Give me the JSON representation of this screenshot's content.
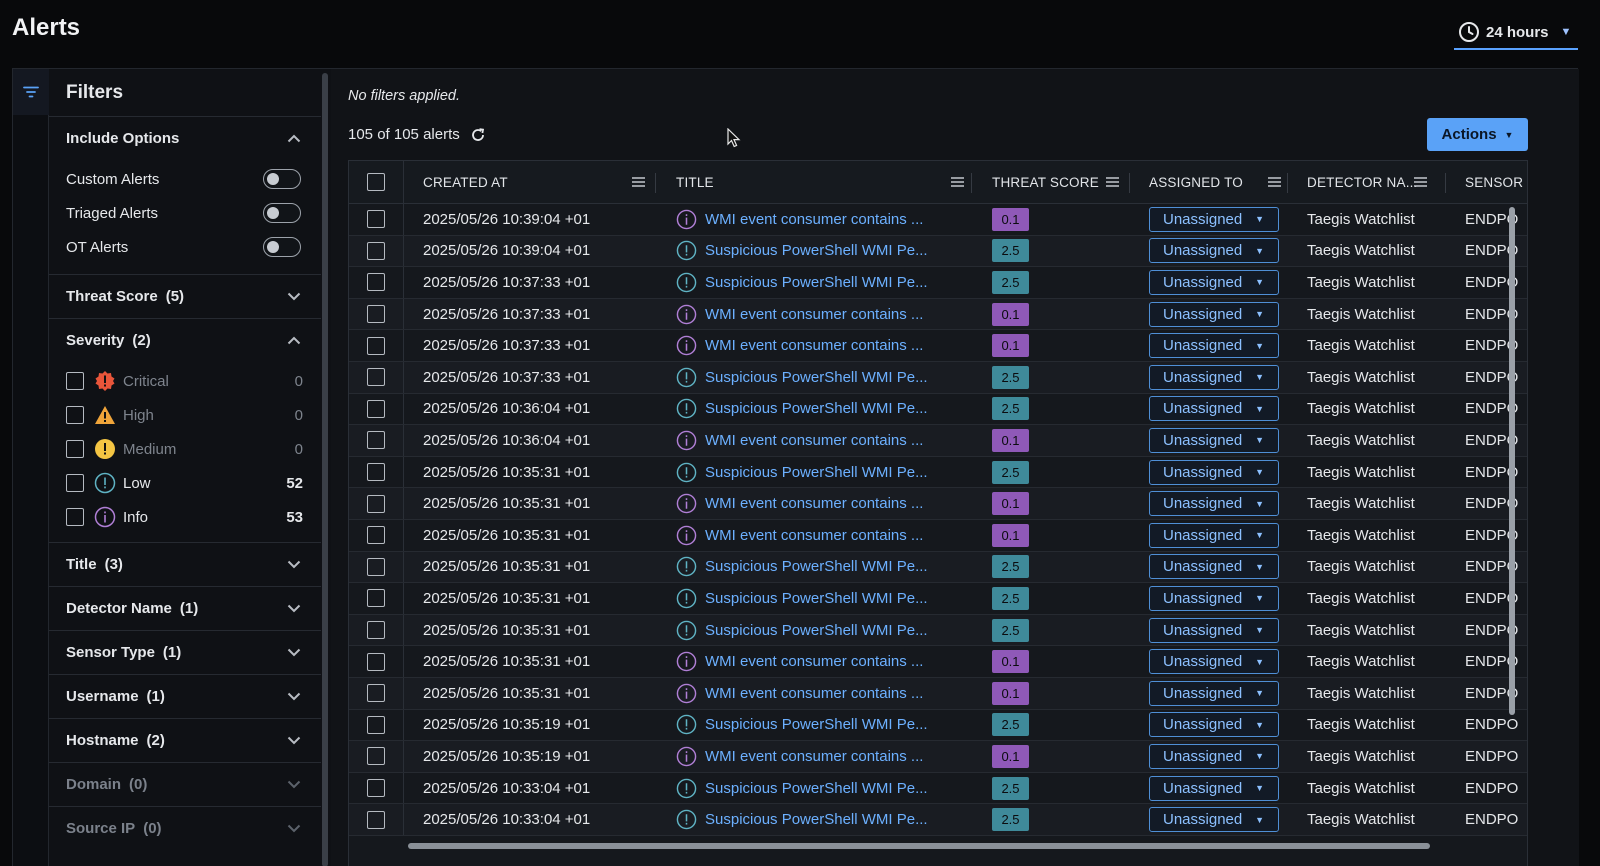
{
  "page": {
    "title": "Alerts"
  },
  "time_range": {
    "label": "24 hours"
  },
  "filters": {
    "title": "Filters",
    "include_options": {
      "label": "Include Options",
      "options": [
        {
          "label": "Custom Alerts",
          "enabled": false
        },
        {
          "label": "Triaged Alerts",
          "enabled": false
        },
        {
          "label": "OT Alerts",
          "enabled": false
        }
      ]
    },
    "threat_score": {
      "label": "Threat Score",
      "count": "(5)"
    },
    "severity": {
      "label": "Severity",
      "count": "(2)",
      "items": [
        {
          "label": "Critical",
          "count": "0",
          "icon": "critical-icon"
        },
        {
          "label": "High",
          "count": "0",
          "icon": "high-icon"
        },
        {
          "label": "Medium",
          "count": "0",
          "icon": "medium-icon"
        },
        {
          "label": "Low",
          "count": "52",
          "icon": "low-icon"
        },
        {
          "label": "Info",
          "count": "53",
          "icon": "info-icon"
        }
      ]
    },
    "title_filter": {
      "label": "Title",
      "count": "(3)"
    },
    "detector_name": {
      "label": "Detector Name",
      "count": "(1)"
    },
    "sensor_type": {
      "label": "Sensor Type",
      "count": "(1)"
    },
    "username": {
      "label": "Username",
      "count": "(1)"
    },
    "hostname": {
      "label": "Hostname",
      "count": "(2)"
    },
    "domain": {
      "label": "Domain",
      "count": "(0)"
    },
    "source_ip": {
      "label": "Source IP",
      "count": "(0)"
    }
  },
  "main": {
    "no_filters": "No filters applied.",
    "summary": "105 of 105 alerts",
    "actions_label": "Actions"
  },
  "table": {
    "columns": {
      "created_at": "CREATED AT",
      "title": "TITLE",
      "threat_score": "THREAT SCORE",
      "assigned_to": "ASSIGNED TO",
      "detector_name": "DETECTOR NA...",
      "sensor_type": "SENSOR T"
    },
    "rows": [
      {
        "created": "2025/05/26 10:39:04 +01",
        "title": "WMI event consumer contains ...",
        "score": "0.1",
        "severity": "info",
        "assigned": "Unassigned",
        "detector": "Taegis Watchlist",
        "sensor": "ENDPO"
      },
      {
        "created": "2025/05/26 10:39:04 +01",
        "title": "Suspicious PowerShell WMI Pe...",
        "score": "2.5",
        "severity": "low",
        "assigned": "Unassigned",
        "detector": "Taegis Watchlist",
        "sensor": "ENDPO"
      },
      {
        "created": "2025/05/26 10:37:33 +01",
        "title": "Suspicious PowerShell WMI Pe...",
        "score": "2.5",
        "severity": "low",
        "assigned": "Unassigned",
        "detector": "Taegis Watchlist",
        "sensor": "ENDPO"
      },
      {
        "created": "2025/05/26 10:37:33 +01",
        "title": "WMI event consumer contains ...",
        "score": "0.1",
        "severity": "info",
        "assigned": "Unassigned",
        "detector": "Taegis Watchlist",
        "sensor": "ENDPO"
      },
      {
        "created": "2025/05/26 10:37:33 +01",
        "title": "WMI event consumer contains ...",
        "score": "0.1",
        "severity": "info",
        "assigned": "Unassigned",
        "detector": "Taegis Watchlist",
        "sensor": "ENDPO"
      },
      {
        "created": "2025/05/26 10:37:33 +01",
        "title": "Suspicious PowerShell WMI Pe...",
        "score": "2.5",
        "severity": "low",
        "assigned": "Unassigned",
        "detector": "Taegis Watchlist",
        "sensor": "ENDPO"
      },
      {
        "created": "2025/05/26 10:36:04 +01",
        "title": "Suspicious PowerShell WMI Pe...",
        "score": "2.5",
        "severity": "low",
        "assigned": "Unassigned",
        "detector": "Taegis Watchlist",
        "sensor": "ENDPO"
      },
      {
        "created": "2025/05/26 10:36:04 +01",
        "title": "WMI event consumer contains ...",
        "score": "0.1",
        "severity": "info",
        "assigned": "Unassigned",
        "detector": "Taegis Watchlist",
        "sensor": "ENDPO"
      },
      {
        "created": "2025/05/26 10:35:31 +01",
        "title": "Suspicious PowerShell WMI Pe...",
        "score": "2.5",
        "severity": "low",
        "assigned": "Unassigned",
        "detector": "Taegis Watchlist",
        "sensor": "ENDPO"
      },
      {
        "created": "2025/05/26 10:35:31 +01",
        "title": "WMI event consumer contains ...",
        "score": "0.1",
        "severity": "info",
        "assigned": "Unassigned",
        "detector": "Taegis Watchlist",
        "sensor": "ENDPO"
      },
      {
        "created": "2025/05/26 10:35:31 +01",
        "title": "WMI event consumer contains ...",
        "score": "0.1",
        "severity": "info",
        "assigned": "Unassigned",
        "detector": "Taegis Watchlist",
        "sensor": "ENDPO"
      },
      {
        "created": "2025/05/26 10:35:31 +01",
        "title": "Suspicious PowerShell WMI Pe...",
        "score": "2.5",
        "severity": "low",
        "assigned": "Unassigned",
        "detector": "Taegis Watchlist",
        "sensor": "ENDPO"
      },
      {
        "created": "2025/05/26 10:35:31 +01",
        "title": "Suspicious PowerShell WMI Pe...",
        "score": "2.5",
        "severity": "low",
        "assigned": "Unassigned",
        "detector": "Taegis Watchlist",
        "sensor": "ENDPO"
      },
      {
        "created": "2025/05/26 10:35:31 +01",
        "title": "Suspicious PowerShell WMI Pe...",
        "score": "2.5",
        "severity": "low",
        "assigned": "Unassigned",
        "detector": "Taegis Watchlist",
        "sensor": "ENDPO"
      },
      {
        "created": "2025/05/26 10:35:31 +01",
        "title": "WMI event consumer contains ...",
        "score": "0.1",
        "severity": "info",
        "assigned": "Unassigned",
        "detector": "Taegis Watchlist",
        "sensor": "ENDPO"
      },
      {
        "created": "2025/05/26 10:35:31 +01",
        "title": "WMI event consumer contains ...",
        "score": "0.1",
        "severity": "info",
        "assigned": "Unassigned",
        "detector": "Taegis Watchlist",
        "sensor": "ENDPO"
      },
      {
        "created": "2025/05/26 10:35:19 +01",
        "title": "Suspicious PowerShell WMI Pe...",
        "score": "2.5",
        "severity": "low",
        "assigned": "Unassigned",
        "detector": "Taegis Watchlist",
        "sensor": "ENDPO"
      },
      {
        "created": "2025/05/26 10:35:19 +01",
        "title": "WMI event consumer contains ...",
        "score": "0.1",
        "severity": "info",
        "assigned": "Unassigned",
        "detector": "Taegis Watchlist",
        "sensor": "ENDPO"
      },
      {
        "created": "2025/05/26 10:33:04 +01",
        "title": "Suspicious PowerShell WMI Pe...",
        "score": "2.5",
        "severity": "low",
        "assigned": "Unassigned",
        "detector": "Taegis Watchlist",
        "sensor": "ENDPO"
      },
      {
        "created": "2025/05/26 10:33:04 +01",
        "title": "Suspicious PowerShell WMI Pe...",
        "score": "2.5",
        "severity": "low",
        "assigned": "Unassigned",
        "detector": "Taegis Watchlist",
        "sensor": "ENDPO"
      }
    ]
  },
  "colors": {
    "accent": "#5aa2f7",
    "link": "#6cb0ff",
    "info_purple": "#8f59b8",
    "low_teal": "#3f8a9a",
    "critical": "#e8553a",
    "high": "#f0a53a",
    "medium": "#f4c543"
  }
}
